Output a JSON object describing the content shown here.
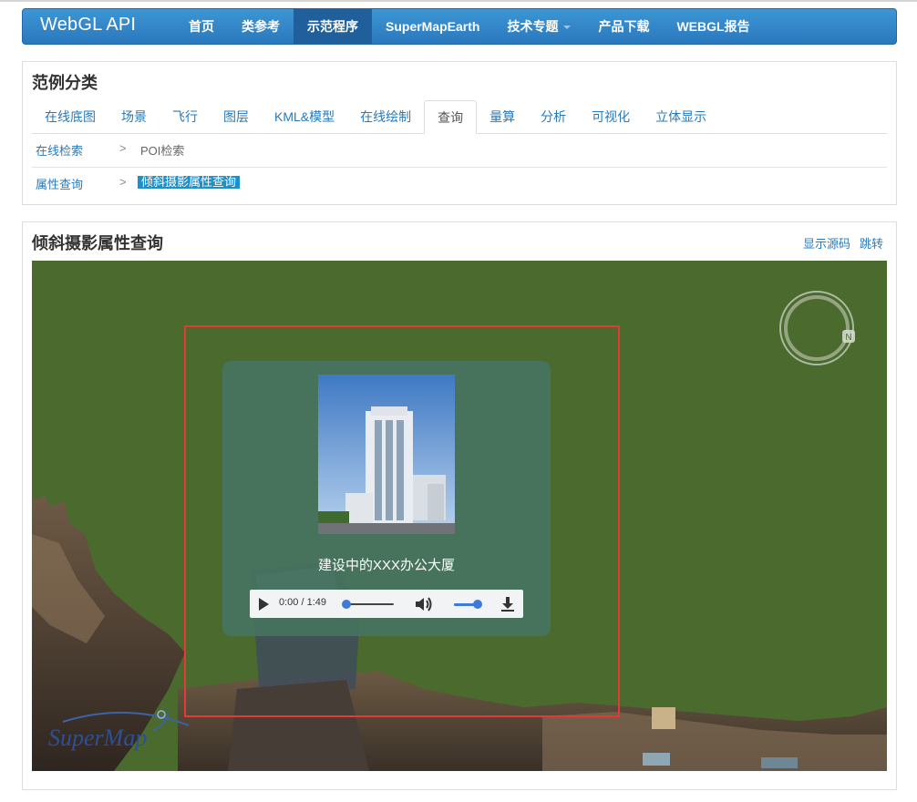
{
  "navbar": {
    "brand": "WebGL API",
    "items": [
      {
        "label": "首页",
        "active": false
      },
      {
        "label": "类参考",
        "active": false
      },
      {
        "label": "示范程序",
        "active": true
      },
      {
        "label": "SuperMapEarth",
        "active": false
      },
      {
        "label": "技术专题",
        "active": false,
        "dropdown": true
      },
      {
        "label": "产品下载",
        "active": false
      },
      {
        "label": "WEBGL报告",
        "active": false
      }
    ]
  },
  "category": {
    "title": "范例分类",
    "tabs": [
      "在线底图",
      "场景",
      "飞行",
      "图层",
      "KML&模型",
      "在线绘制",
      "查询",
      "量算",
      "分析",
      "可视化",
      "立体显示"
    ],
    "active_tab": "查询",
    "rows": [
      {
        "label": "在线检索",
        "separator": ">",
        "item": "POI检索"
      },
      {
        "label": "属性查询",
        "separator": ">",
        "item": "倾斜摄影属性查询"
      }
    ]
  },
  "demo": {
    "title": "倾斜摄影属性查询",
    "links": [
      "显示源码",
      "跳转"
    ],
    "popup": {
      "name": "建设中的XXX办公大厦",
      "audio": {
        "time": "0:00 / 1:49",
        "progress": 0,
        "volume": 1
      }
    },
    "logo_text": "SuperMap"
  },
  "colors": {
    "nav_top": "#3d96d3",
    "nav_bottom": "#2a78be",
    "link": "#2a79b8",
    "scene_bg": "#4b6a2d",
    "highlight": "#e53935"
  }
}
